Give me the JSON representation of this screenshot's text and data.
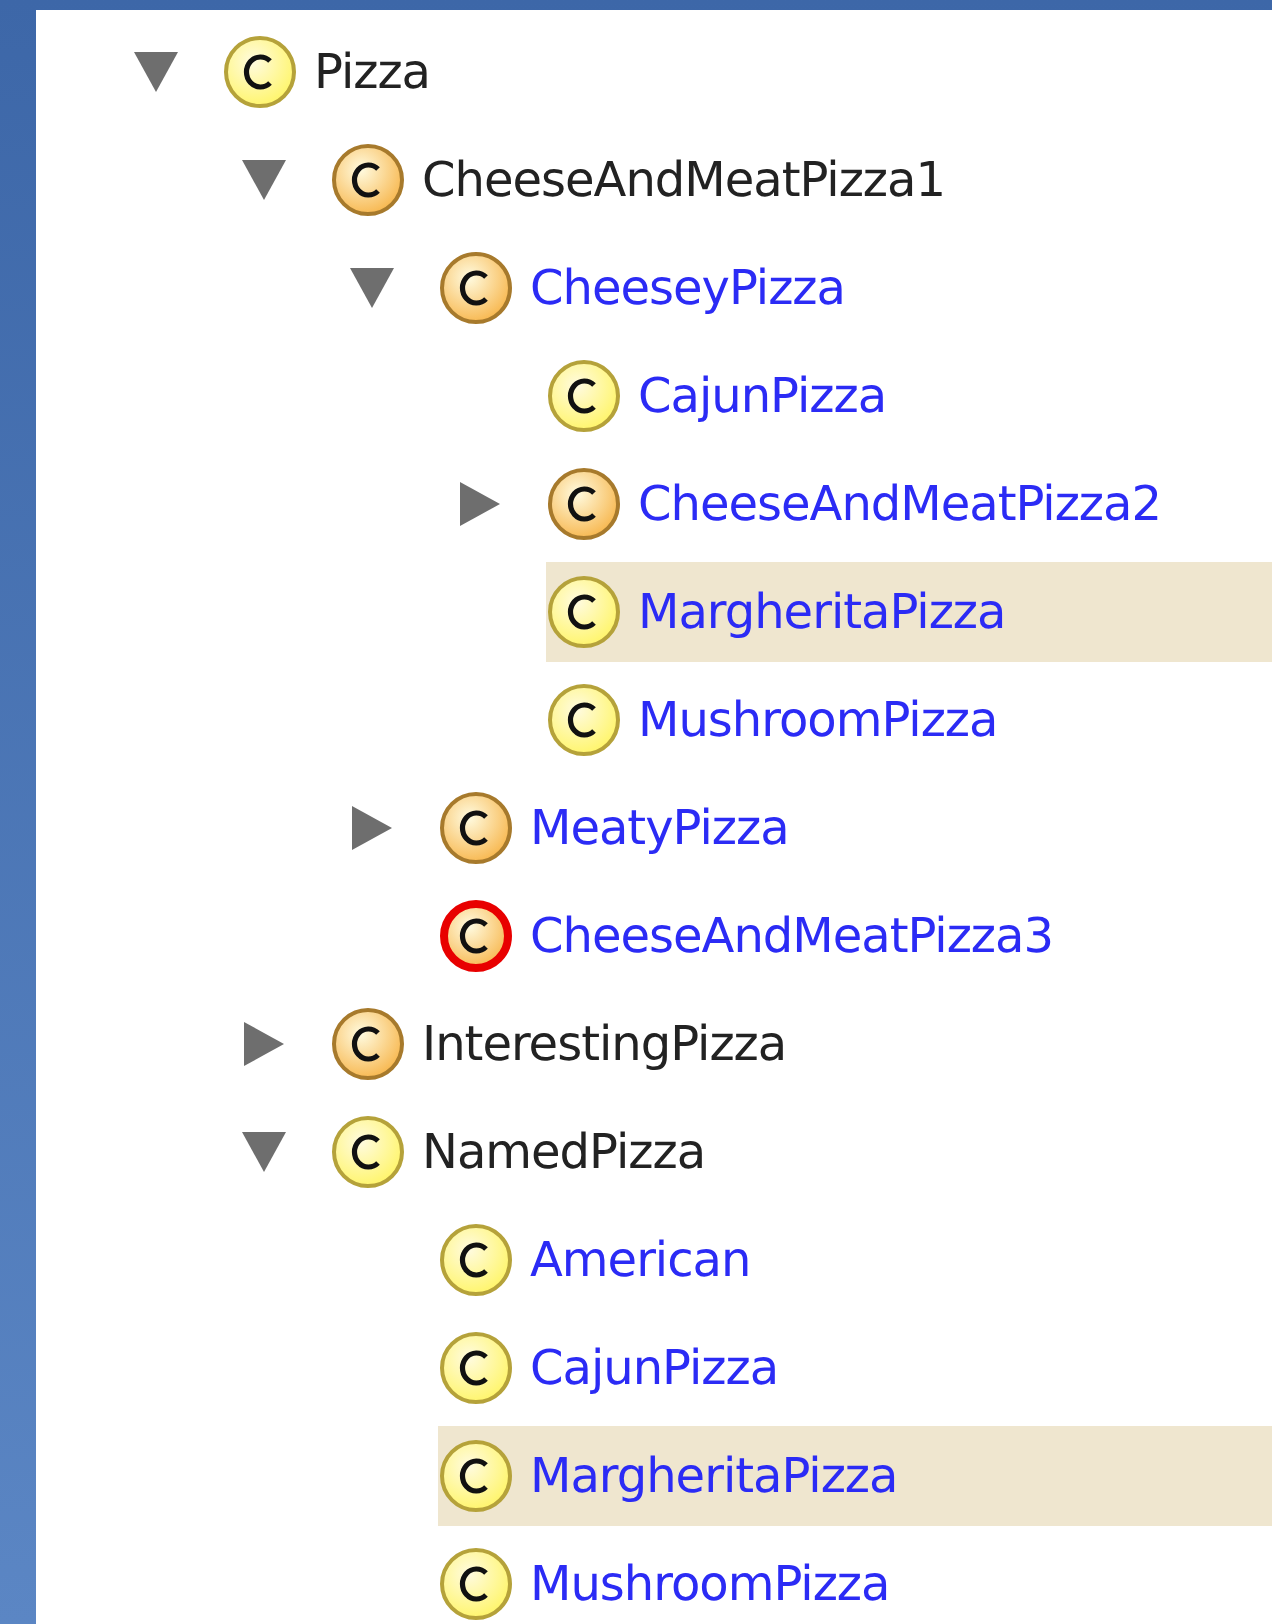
{
  "tree": [
    {
      "label": "Pizza",
      "kind": "primitive",
      "inferred": false,
      "selected": false,
      "expanded": true,
      "children": [
        {
          "label": "CheeseAndMeatPizza1",
          "kind": "defined",
          "inferred": false,
          "selected": false,
          "expanded": true,
          "children": [
            {
              "label": "CheeseyPizza",
              "kind": "defined",
              "inferred": true,
              "selected": false,
              "expanded": true,
              "children": [
                {
                  "label": "CajunPizza",
                  "kind": "primitive",
                  "inferred": true,
                  "selected": false
                },
                {
                  "label": "CheeseAndMeatPizza2",
                  "kind": "defined",
                  "inferred": true,
                  "selected": false,
                  "expanded": false
                },
                {
                  "label": "MargheritaPizza",
                  "kind": "primitive",
                  "inferred": true,
                  "selected": true
                },
                {
                  "label": "MushroomPizza",
                  "kind": "primitive",
                  "inferred": true,
                  "selected": false
                }
              ]
            },
            {
              "label": "MeatyPizza",
              "kind": "defined",
              "inferred": true,
              "selected": false,
              "expanded": false
            },
            {
              "label": "CheeseAndMeatPizza3",
              "kind": "unsatisfiable",
              "inferred": true,
              "selected": false
            }
          ]
        },
        {
          "label": "InterestingPizza",
          "kind": "defined",
          "inferred": false,
          "selected": false,
          "expanded": false
        },
        {
          "label": "NamedPizza",
          "kind": "primitive",
          "inferred": false,
          "selected": false,
          "expanded": true,
          "children": [
            {
              "label": "American",
              "kind": "primitive",
              "inferred": true,
              "selected": false
            },
            {
              "label": "CajunPizza",
              "kind": "primitive",
              "inferred": true,
              "selected": false
            },
            {
              "label": "MargheritaPizza",
              "kind": "primitive",
              "inferred": true,
              "selected": true
            },
            {
              "label": "MushroomPizza",
              "kind": "primitive",
              "inferred": true,
              "selected": false
            }
          ]
        }
      ]
    }
  ]
}
